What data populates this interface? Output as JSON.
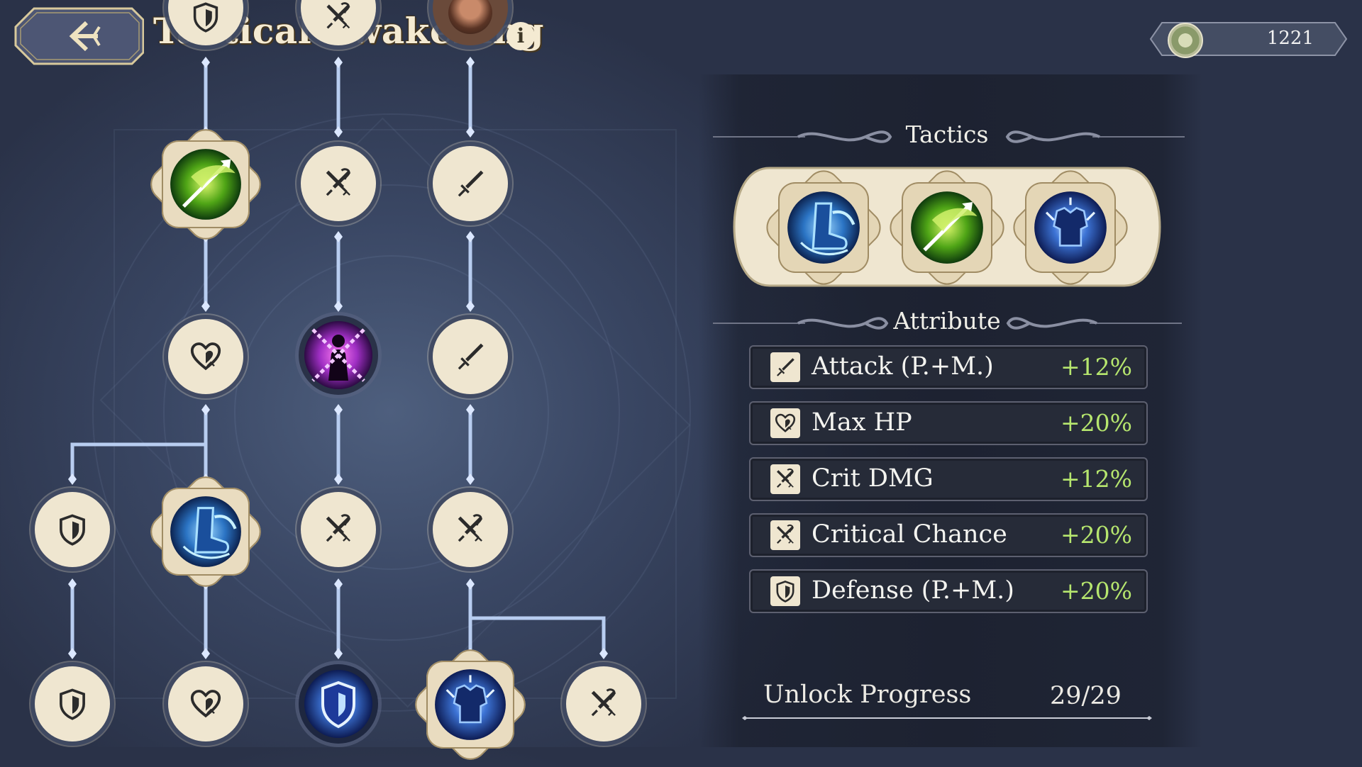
{
  "header": {
    "title": "Tactical Awakening",
    "info_glyph": "i",
    "back_icon": "back-arrow-icon",
    "currency": {
      "icon": "compass-token-icon",
      "value": "1221"
    }
  },
  "skill_tree": {
    "nodes": [
      {
        "id": "top-1",
        "icon": "shield-icon"
      },
      {
        "id": "top-2",
        "icon": "crossed-swords-icon"
      },
      {
        "id": "top-3",
        "icon": "hero-portrait-icon"
      },
      {
        "id": "r1-c2",
        "icon": "green-spear-skill-icon",
        "type": "skill"
      },
      {
        "id": "r1-c3",
        "icon": "crit-swords-icon"
      },
      {
        "id": "r1-c4",
        "icon": "sword-icon"
      },
      {
        "id": "r2-c2",
        "icon": "heart-icon"
      },
      {
        "id": "r2-c3",
        "icon": "chained-figure-skill-icon",
        "type": "skill"
      },
      {
        "id": "r2-c4",
        "icon": "sword-icon"
      },
      {
        "id": "r3-c1",
        "icon": "shield-icon"
      },
      {
        "id": "r3-c2",
        "icon": "blue-boot-skill-icon",
        "type": "skill"
      },
      {
        "id": "r3-c3",
        "icon": "crit-swords-icon"
      },
      {
        "id": "r3-c4",
        "icon": "crit-swords-icon"
      },
      {
        "id": "r4-c1",
        "icon": "shield-icon"
      },
      {
        "id": "r4-c2",
        "icon": "heart-icon"
      },
      {
        "id": "r4-c3",
        "icon": "glowing-shield-skill-icon",
        "type": "skill"
      },
      {
        "id": "r4-c4",
        "icon": "lightning-armor-skill-icon",
        "type": "skill"
      },
      {
        "id": "r4-c5",
        "icon": "crit-swords-icon"
      }
    ]
  },
  "tactics": {
    "title": "Tactics",
    "slots": [
      {
        "icon": "blue-boot-skill-icon"
      },
      {
        "icon": "green-spear-skill-icon"
      },
      {
        "icon": "lightning-armor-skill-icon"
      }
    ]
  },
  "attribute": {
    "title": "Attribute",
    "rows": [
      {
        "icon": "sword-icon",
        "name": "Attack (P.+M.)",
        "value": "+12%"
      },
      {
        "icon": "heart-icon",
        "name": "Max HP",
        "value": "+20%"
      },
      {
        "icon": "crit-swords-icon",
        "name": "Crit DMG",
        "value": "+12%"
      },
      {
        "icon": "crit-swords-icon",
        "name": "Critical Chance",
        "value": "+20%"
      },
      {
        "icon": "shield-icon",
        "name": "Defense (P.+M.)",
        "value": "+20%"
      }
    ]
  },
  "unlock_progress": {
    "label": "Unlock Progress",
    "value": "29/29"
  },
  "colors": {
    "accent_value": "#b6e66e",
    "node_fill": "#efe6d0",
    "link_line": "#b8cdf0",
    "background": "#2a3248"
  }
}
